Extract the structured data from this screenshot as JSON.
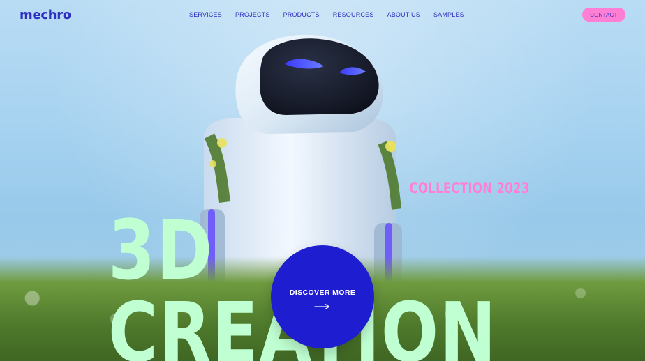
{
  "brand": {
    "logo_text": "mechro"
  },
  "nav": {
    "items": [
      {
        "label": "SERVICES"
      },
      {
        "label": "PROJECTS"
      },
      {
        "label": "PRODUCTS"
      },
      {
        "label": "RESOURCES"
      },
      {
        "label": "ABOUT US"
      },
      {
        "label": "SAMPLES"
      }
    ],
    "contact_label": "CONTACT"
  },
  "hero": {
    "collection_label": "COLLECTION 2023",
    "headline": "3D CREATION",
    "cta_label": "DISCOVER MORE",
    "cta_icon": "arrow-right-icon"
  },
  "colors": {
    "brand_blue": "#2f2fbf",
    "cta_blue": "#1e1ed0",
    "accent_pink": "#ff7fd5",
    "headline_mint": "#bfffd1",
    "sky": "#a6d2f0"
  }
}
